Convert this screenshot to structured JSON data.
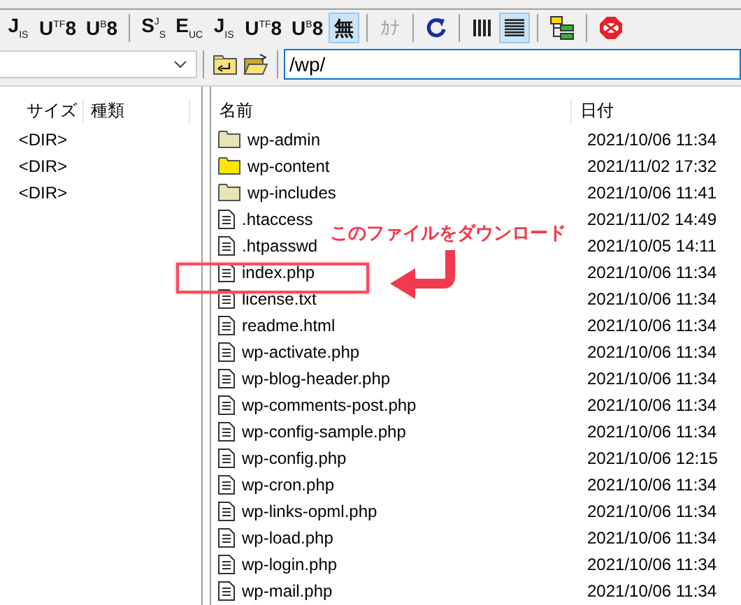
{
  "toolbar": [
    {
      "kind": "text",
      "label": "J$_{IS}$",
      "selected": false,
      "disabled": false
    },
    {
      "kind": "text",
      "label": "U$^{TF}$8",
      "selected": false,
      "disabled": false
    },
    {
      "kind": "text",
      "label": "U$^{B}$8",
      "selected": false,
      "disabled": false
    },
    {
      "kind": "sep"
    },
    {
      "kind": "text",
      "label": "S$^{J}$$_{S}$",
      "selected": false,
      "disabled": false
    },
    {
      "kind": "text",
      "label": "E$_{UC}$",
      "selected": false,
      "disabled": false
    },
    {
      "kind": "text",
      "label": "J$_{IS}$",
      "selected": false,
      "disabled": false
    },
    {
      "kind": "text",
      "label": "U$^{TF}$8",
      "selected": false,
      "disabled": false
    },
    {
      "kind": "text",
      "label": "U$^{B}$8",
      "selected": false,
      "disabled": false
    },
    {
      "kind": "text",
      "label": "無",
      "selected": true,
      "disabled": false
    },
    {
      "kind": "sep"
    },
    {
      "kind": "text",
      "label": "ｶﾅ",
      "selected": false,
      "disabled": true
    },
    {
      "kind": "sep"
    },
    {
      "kind": "refresh",
      "selected": false
    },
    {
      "kind": "sep"
    },
    {
      "kind": "list",
      "selected": false
    },
    {
      "kind": "details",
      "selected": true
    },
    {
      "kind": "sep"
    },
    {
      "kind": "tree",
      "selected": false
    },
    {
      "kind": "sep"
    },
    {
      "kind": "stop",
      "selected": false
    }
  ],
  "path": {
    "value": "/wp/"
  },
  "left_pane": {
    "columns": [
      "サイズ",
      "種類"
    ],
    "rows": [
      "<DIR>",
      "<DIR>",
      "<DIR>"
    ]
  },
  "right_pane": {
    "columns": [
      "名前",
      "日付"
    ],
    "rows": [
      {
        "kind": "folder",
        "name": "wp-admin",
        "date": "2021/10/06 11:34"
      },
      {
        "kind": "folder",
        "name": "wp-content",
        "date": "2021/11/02 17:32"
      },
      {
        "kind": "folder",
        "name": "wp-includes",
        "date": "2021/10/06 11:41"
      },
      {
        "kind": "file",
        "name": ".htaccess",
        "date": "2021/11/02 14:49"
      },
      {
        "kind": "file",
        "name": ".htpasswd",
        "date": "2021/10/05 14:11"
      },
      {
        "kind": "file",
        "name": "index.php",
        "date": "2021/10/06 11:34"
      },
      {
        "kind": "file",
        "name": "license.txt",
        "date": "2021/10/06 11:34"
      },
      {
        "kind": "file",
        "name": "readme.html",
        "date": "2021/10/06 11:34"
      },
      {
        "kind": "file",
        "name": "wp-activate.php",
        "date": "2021/10/06 11:34"
      },
      {
        "kind": "file",
        "name": "wp-blog-header.php",
        "date": "2021/10/06 11:34"
      },
      {
        "kind": "file",
        "name": "wp-comments-post.php",
        "date": "2021/10/06 11:34"
      },
      {
        "kind": "file",
        "name": "wp-config-sample.php",
        "date": "2021/10/06 11:34"
      },
      {
        "kind": "file",
        "name": "wp-config.php",
        "date": "2021/10/06 12:15"
      },
      {
        "kind": "file",
        "name": "wp-cron.php",
        "date": "2021/10/06 11:34"
      },
      {
        "kind": "file",
        "name": "wp-links-opml.php",
        "date": "2021/10/06 11:34"
      },
      {
        "kind": "file",
        "name": "wp-load.php",
        "date": "2021/10/06 11:34"
      },
      {
        "kind": "file",
        "name": "wp-login.php",
        "date": "2021/10/06 11:34"
      },
      {
        "kind": "file",
        "name": "wp-mail.php",
        "date": "2021/10/06 11:34"
      }
    ]
  },
  "annotation": {
    "text": "このファイルをダウンロード"
  }
}
